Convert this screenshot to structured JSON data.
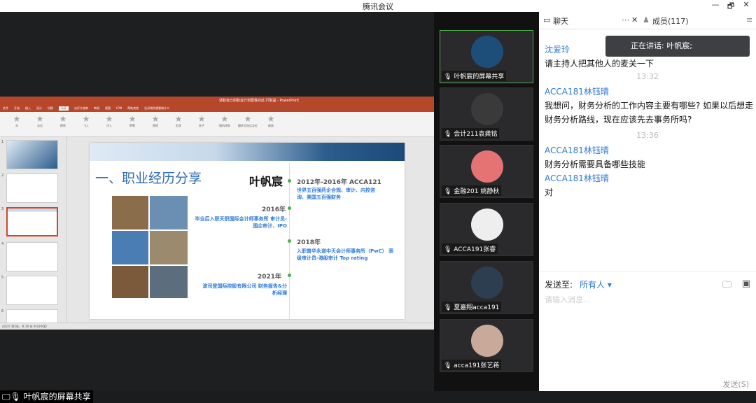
{
  "window": {
    "title": "腾讯会议",
    "min": "—",
    "max": "🗗",
    "close": "✕"
  },
  "ppt": {
    "title_bar": "述职自己的职业计划暨我对此 行职益 - PowerPoint",
    "tabs": [
      "文件",
      "开始",
      "插入",
      "设计",
      "切换",
      "动画",
      "幻灯片放映",
      "审阅",
      "视图",
      "LPM",
      "帮助其他",
      "告诉我你想要做什么"
    ],
    "active_tab": "动画",
    "ribbon_items": [
      "无",
      "淡出",
      "擦除",
      "飞入",
      "浮入",
      "劈裂",
      "擦除",
      "形状",
      "轮子",
      "随机线条",
      "翻转式由远及近",
      "缩放"
    ],
    "slide": {
      "heading": "一、职业经历分享",
      "name": "叶帆宸",
      "entries": [
        {
          "year": "2012年-2016年 ACCA121",
          "desc": "世界五百强药企合规、审计、内控咨询、美国五百强财务"
        },
        {
          "year": "2016年",
          "desc": "毕业后入职天职国际会计师事务所 审计员-国企审计、IPO"
        },
        {
          "year": "2018年",
          "desc": "入职普华永道中天会计师事务所（PwC） 高级审计员-港股审计 Top rating"
        },
        {
          "year": "2021年",
          "desc": "波司登国际控股有限公司 财务报告&分析经理"
        }
      ],
      "nums": [
        "2",
        "3",
        "4"
      ]
    },
    "status": "幻灯片 第3张，共 30 张   中文(中国)"
  },
  "share_label": "叶帆宸的屏幕共享",
  "videos": [
    {
      "label": "叶帆宸的屏幕共享",
      "color": "#1d4e7a"
    },
    {
      "label": "会计211袁龚铭",
      "color": "#3a3a3a"
    },
    {
      "label": "金融201 姚静秋",
      "color": "#e57373"
    },
    {
      "label": "ACCA191张睿",
      "color": "#eeeeee"
    },
    {
      "label": "夏嘉翔acca191",
      "color": "#2c3e50"
    },
    {
      "label": "acca191张艺蒋",
      "color": "#c8a99a"
    }
  ],
  "chat": {
    "tab_chat": "聊天",
    "tab_members": "成员(117)",
    "speaking": "正在讲话: 叶帆宸;",
    "messages": [
      {
        "sender": "沈爱玲",
        "text": "请主持人把其他人的麦关一下"
      },
      {
        "time": "13:32"
      },
      {
        "sender": "ACCA181林钰晴",
        "text": "我想问，财务分析的工作内容主要有哪些? 如果以后想走财务分析路线，现在应该先去事务所吗?"
      },
      {
        "time": "13:36"
      },
      {
        "sender": "ACCA181林钰晴",
        "text": "财务分析需要具备哪些技能"
      },
      {
        "sender": "ACCA181林钰晴",
        "text": "对"
      }
    ],
    "send_to_label": "发送至:",
    "send_to_value": "所有人 ▾",
    "input_placeholder": "请输入消息...",
    "send_button": "发送(S)"
  }
}
